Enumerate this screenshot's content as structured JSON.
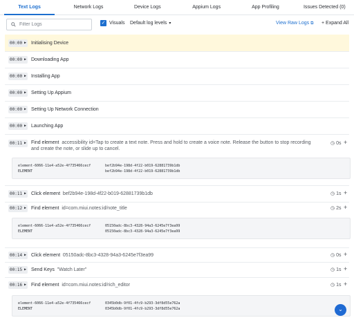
{
  "tabs": [
    {
      "label": "Text Logs",
      "active": true
    },
    {
      "label": "Network Logs"
    },
    {
      "label": "Device Logs"
    },
    {
      "label": "Appium Logs"
    },
    {
      "label": "App Profiling"
    },
    {
      "label": "Issues Detected (0)"
    }
  ],
  "toolbar": {
    "filter_placeholder": "Filter Logs",
    "visuals_label": "Visuals",
    "visuals_checked": true,
    "log_levels_label": "Default log levels",
    "view_raw_logs_label": "View Raw Logs",
    "expand_all_label": "+ Expand All"
  },
  "colors": {
    "accent": "#1d6fcf",
    "highlight_row": "#fff8dc"
  },
  "logs": [
    {
      "time": "00:00",
      "text": "Initialising Device"
    },
    {
      "time": "00:00",
      "text": "Downloading App"
    },
    {
      "time": "00:00",
      "text": "Installing App"
    },
    {
      "time": "00:00",
      "text": "Setting Up Appium"
    },
    {
      "time": "00:00",
      "text": "Setting Up Network Connection"
    },
    {
      "time": "00:00",
      "text": "Launching App"
    },
    {
      "time": "00:11",
      "text": "Find element",
      "arg_line1": "accessibility id=Tap to create a text note. Press and hold to create a voice note. Release the button to stop recording",
      "arg_line2": "and create the note, or slide up to cancel.",
      "duration": "0s"
    },
    {
      "time": "00:11",
      "text": "Click element",
      "arg": "bef2b94e-198d-4f22-b019-62881739b1db",
      "duration": "1s"
    },
    {
      "time": "00:12",
      "text": "Find element",
      "arg": "id=com.miui.notes:id/note_title",
      "duration": "2s"
    },
    {
      "time": "00:14",
      "text": "Click element",
      "arg": "05150adc-8bc3-4328-94a3-6245e7f3ea99",
      "duration": "0s"
    },
    {
      "time": "00:15",
      "text": "Send Keys",
      "arg": "\"Watch Later\"",
      "duration": "1s"
    },
    {
      "time": "00:16",
      "text": "Find element",
      "arg": "id=com.miui.notes:id/rich_editor",
      "duration": "1s"
    }
  ],
  "details": [
    {
      "k1": "element-6066-11e4-a52e-4f735466cecf",
      "v1": "bef2b94e-198d-4f22-b019-62881739b1db",
      "k2": "ELEMENT",
      "v2": "bef2b94e-198d-4f22-b019-62881739b1db"
    },
    {
      "k1": "element-6066-11e4-a52e-4f735466cecf",
      "v1": "05150adc-8bc3-4328-94a3-6245e7f3ea99",
      "k2": "ELEMENT",
      "v2": "05150adc-8bc3-4328-94a3-6245e7f3ea99"
    },
    {
      "k1": "element-6066-11e4-a52e-4f735466cecf",
      "v1": "0345b0db-9f01-4fc9-b293-3df8d55e762a",
      "k2": "ELEMENT",
      "v2": "0345b0db-9f01-4fc9-b293-3df8d55e762a"
    }
  ]
}
